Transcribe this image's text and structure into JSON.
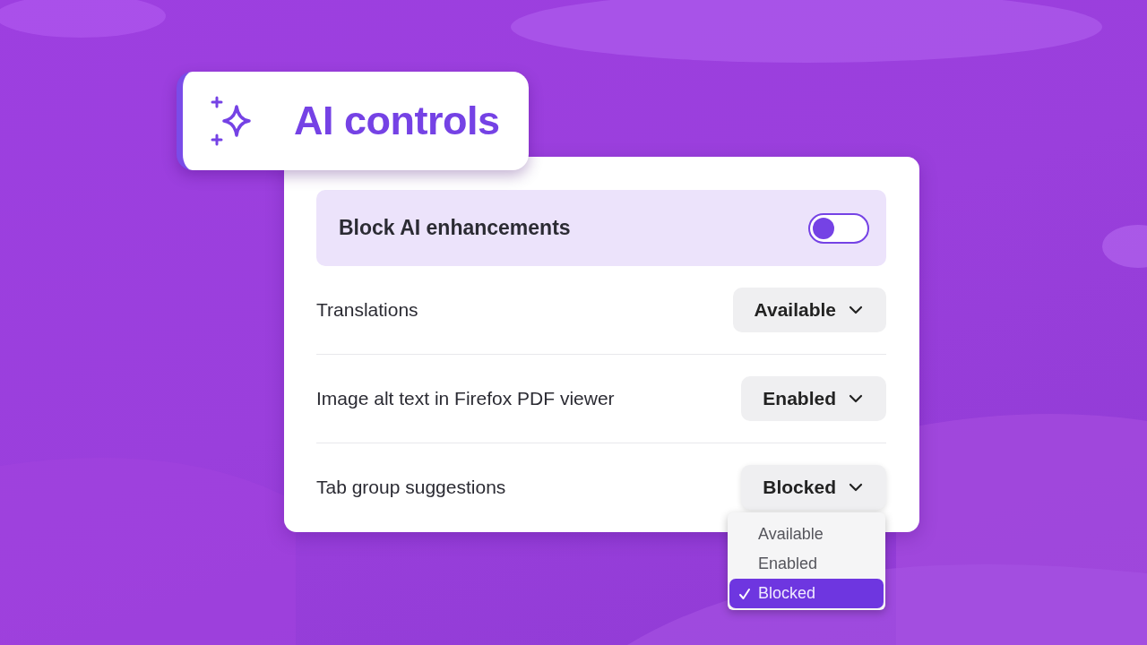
{
  "title": "AI controls",
  "block_toggle": {
    "label": "Block AI enhancements",
    "on": false
  },
  "settings": [
    {
      "label": "Translations",
      "value": "Available",
      "open": false
    },
    {
      "label": "Image alt text in Firefox PDF viewer",
      "value": "Enabled",
      "open": false
    },
    {
      "label": "Tab group suggestions",
      "value": "Blocked",
      "open": true
    }
  ],
  "dropdown": {
    "options": [
      {
        "label": "Available",
        "selected": false
      },
      {
        "label": "Enabled",
        "selected": false
      },
      {
        "label": "Blocked",
        "selected": true
      }
    ]
  }
}
